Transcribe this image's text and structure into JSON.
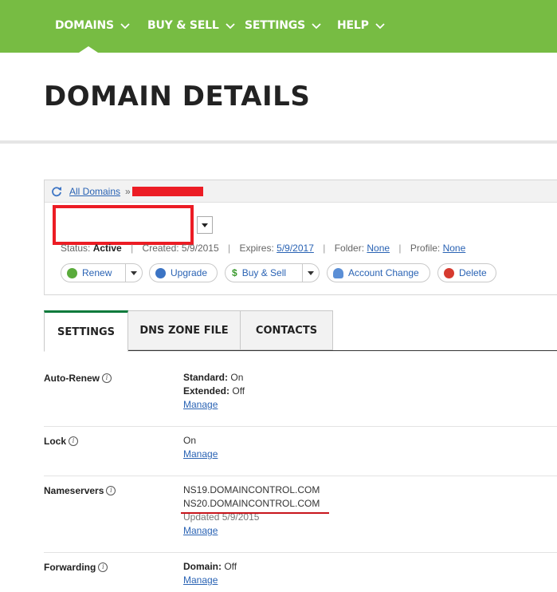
{
  "nav": {
    "items": [
      {
        "label": "DOMAINS"
      },
      {
        "label": "BUY & SELL"
      },
      {
        "label": "SETTINGS"
      },
      {
        "label": "HELP"
      }
    ]
  },
  "page": {
    "title": "DOMAIN DETAILS"
  },
  "breadcrumb": {
    "link": "All Domains",
    "separator": "»"
  },
  "domain": {
    "status_label": "Status:",
    "status_value": "Active",
    "created_label": "Created:",
    "created_value": "5/9/2015",
    "expires_label": "Expires:",
    "expires_value": "5/9/2017",
    "folder_label": "Folder:",
    "folder_value": "None",
    "profile_label": "Profile:",
    "profile_value": "None"
  },
  "actions": {
    "renew": "Renew",
    "upgrade": "Upgrade",
    "buy_sell": "Buy & Sell",
    "account_change": "Account Change",
    "delete": "Delete"
  },
  "tabs": [
    {
      "label": "SETTINGS",
      "active": true
    },
    {
      "label": "DNS ZONE FILE",
      "active": false
    },
    {
      "label": "CONTACTS",
      "active": false
    }
  ],
  "settings": {
    "auto_renew": {
      "label": "Auto-Renew",
      "standard_label": "Standard:",
      "standard_value": "On",
      "extended_label": "Extended:",
      "extended_value": "Off",
      "manage": "Manage"
    },
    "lock": {
      "label": "Lock",
      "value": "On",
      "manage": "Manage"
    },
    "nameservers": {
      "label": "Nameservers",
      "ns1": "NS19.DOMAINCONTROL.COM",
      "ns2": "NS20.DOMAINCONTROL.COM",
      "updated": "Updated 5/9/2015",
      "manage": "Manage"
    },
    "forwarding": {
      "label": "Forwarding",
      "domain_label": "Domain:",
      "domain_value": "Off",
      "manage": "Manage"
    }
  },
  "colors": {
    "nav_green": "#77bc43",
    "link_blue": "#2a63b4",
    "redaction_red": "#ec1c24",
    "active_tab_top": "#0b7a3b"
  }
}
